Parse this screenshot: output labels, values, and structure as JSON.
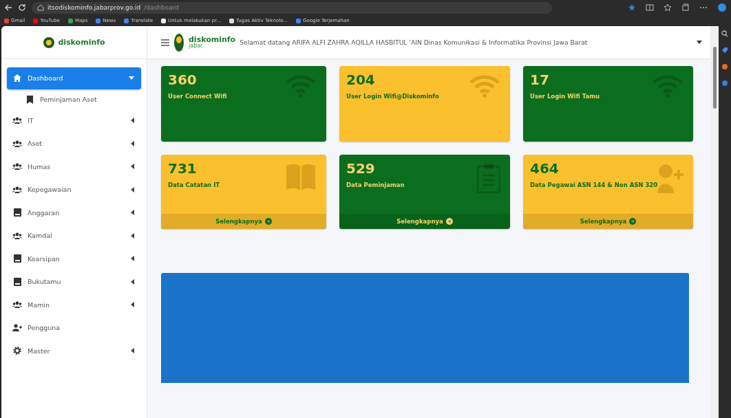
{
  "browser": {
    "url_host": "itsodiskominfo.jabarprov.go.id",
    "url_path": "/dashboard",
    "bookmarks": [
      {
        "label": "Gmail",
        "color": "#e94235"
      },
      {
        "label": "YouTube",
        "color": "#ff0000"
      },
      {
        "label": "Maps",
        "color": "#34a853"
      },
      {
        "label": "News",
        "color": "#4285f4"
      },
      {
        "label": "Translate",
        "color": "#4285f4"
      },
      {
        "label": "Untuk melakukan pr...",
        "color": "#eeeeee"
      },
      {
        "label": "Tugas Aktiv Teknolo...",
        "color": "#dddddd"
      },
      {
        "label": "Google Terjemahan",
        "color": "#4285f4"
      }
    ]
  },
  "brand": {
    "logo": "diskominfo"
  },
  "header": {
    "logo": "diskominfo",
    "logo_sub": "jabar",
    "welcome": "Selamat datang ARIFA ALFI ZAHRA AQILLA HASBITUL 'AIN Dinas Komunikasi & Informatika Provinsi Jawa Barat"
  },
  "sidebar": {
    "items": [
      {
        "label": "Dashboard",
        "kind": "home",
        "selected": true,
        "expanded": true,
        "children": [
          {
            "label": "Peminjaman Aset",
            "selected": false
          }
        ]
      },
      {
        "label": "IT",
        "kind": "users",
        "selected": false,
        "expanded": false
      },
      {
        "label": "Aset",
        "kind": "users",
        "selected": false,
        "expanded": false
      },
      {
        "label": "Humas",
        "kind": "users",
        "selected": false,
        "expanded": false
      },
      {
        "label": "Kepegawaian",
        "kind": "users",
        "selected": false,
        "expanded": false
      },
      {
        "label": "Anggaran",
        "kind": "book",
        "selected": false,
        "expanded": false
      },
      {
        "label": "Kamdal",
        "kind": "users",
        "selected": false,
        "expanded": false
      },
      {
        "label": "Kearsipan",
        "kind": "book",
        "selected": false,
        "expanded": false
      },
      {
        "label": "Bukutamu",
        "kind": "book",
        "selected": false,
        "expanded": false
      },
      {
        "label": "Mamin",
        "kind": "users",
        "selected": false,
        "expanded": false
      },
      {
        "label": "Pengguna",
        "kind": "userplus",
        "selected": false
      },
      {
        "label": "Master",
        "kind": "gear",
        "selected": false,
        "expanded": false
      }
    ]
  },
  "cards": [
    {
      "value": "360",
      "label": "User Connect Wifi",
      "color": "#0b6e1e",
      "kind": "wifi"
    },
    {
      "value": "204",
      "label": "User Login Wifi@Diskominfo",
      "color": "#fbc02d",
      "kind": "wifi"
    },
    {
      "value": "17",
      "label": "User Login Wifi Tamu",
      "color": "#0b6e1e",
      "kind": "wifi"
    },
    {
      "value": "731",
      "label": "Data Catatan IT",
      "color": "#fbc02d",
      "kind": "book",
      "link": "Selengkapnya"
    },
    {
      "value": "529",
      "label": "Data Peminjaman",
      "color": "#0b6e1e",
      "kind": "clipboard",
      "link": "Selengkapnya"
    },
    {
      "value": "464",
      "label": "Data Pegawai ASN 144 & Non ASN 320",
      "color": "#fbc02d",
      "kind": "userplus",
      "link": "Selengkapnya"
    }
  ]
}
